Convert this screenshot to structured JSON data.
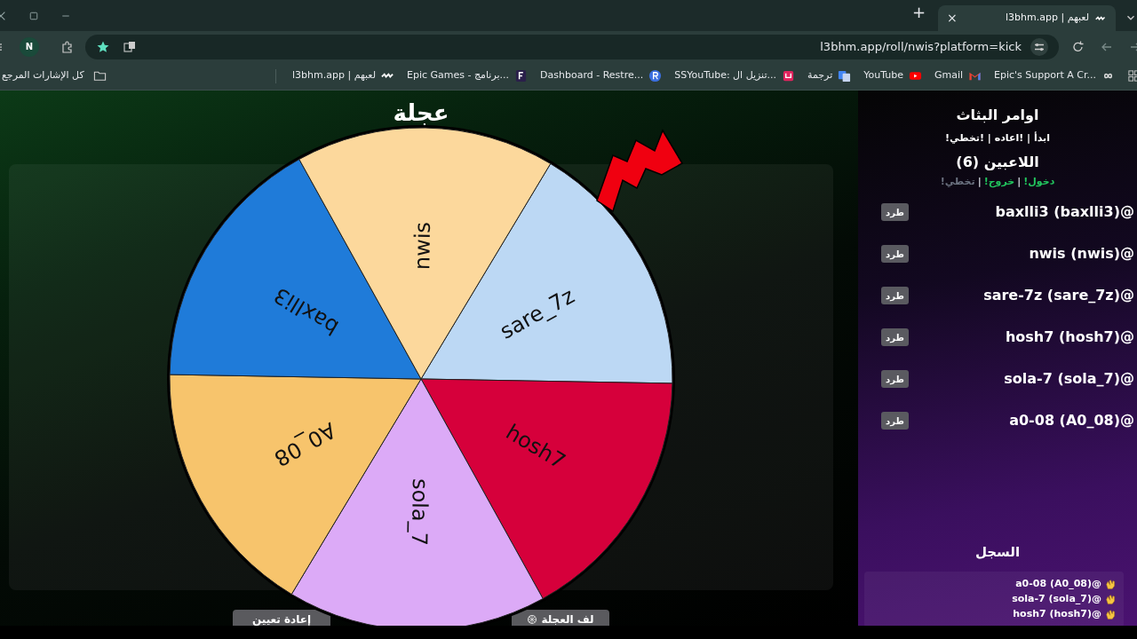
{
  "browser": {
    "tab": {
      "title": "l3bhm.app | لعبهم",
      "close": "×"
    },
    "new_tab": "+",
    "url": "l3bhm.app/roll/nwis?platform=kick",
    "avatar": "N",
    "bookmarks": [
      {
        "label": "Epic's Support A Cr...",
        "kind": "infinity"
      },
      {
        "label": "Gmail",
        "kind": "gmail"
      },
      {
        "label": "YouTube",
        "kind": "youtube"
      },
      {
        "label": "ترجمة",
        "kind": "translate"
      },
      {
        "label": "SSYouTube: تنزيل ال...",
        "kind": "square"
      },
      {
        "label": "Dashboard - Restre...",
        "kind": "r"
      },
      {
        "label": "Epic Games - برنامج...",
        "kind": "f"
      },
      {
        "label": "l3bhm.app | لعبهم",
        "kind": "site"
      }
    ],
    "all_bookmarks": "كل الإشارات المرجع"
  },
  "wheel": {
    "title": "عجلة",
    "slices": [
      {
        "label": "sare_7z",
        "color": "#bcd8f4"
      },
      {
        "label": "hosh7",
        "color": "#d6003b"
      },
      {
        "label": "sola_7",
        "color": "#dcaaf7"
      },
      {
        "label": "A0_08",
        "color": "#f7c46c"
      },
      {
        "label": "baxlli3",
        "color": "#1f7bd9"
      },
      {
        "label": "nwis",
        "color": "#fcd89c"
      }
    ],
    "buttons": [
      {
        "label": "لف العجلة",
        "kind": "spin"
      },
      {
        "label": "إعادة تعيين",
        "kind": "reset"
      }
    ]
  },
  "panel": {
    "title": "اوامر البثاث",
    "commands": "!ابدأ | !اعاده | !تخطي",
    "players_title": "اللاعبين (6)",
    "legend": [
      {
        "label": "!دخول",
        "color": "#22c55e"
      },
      {
        "label": "!خروج",
        "color": "#22c55e"
      },
      {
        "label": "!تخطي",
        "color": "#6b7280"
      }
    ],
    "legend_separator": "|",
    "players": [
      {
        "name": "baxlli3 (baxlli3)@",
        "action": "طرد"
      },
      {
        "name": "nwis (nwis)@",
        "action": "طرد"
      },
      {
        "name": "sare-7z (sare_7z)@",
        "action": "طرد"
      },
      {
        "name": "hosh7 (hosh7)@",
        "action": "طرد"
      },
      {
        "name": "sola-7 (sola_7)@",
        "action": "طرد"
      },
      {
        "name": "a0-08 (A0_08)@",
        "action": "طرد"
      }
    ],
    "log_title": "السجل",
    "log": [
      "a0-08 (A0_08)@",
      "sola-7 (sola_7)@",
      "hosh7 (hosh7)@"
    ]
  }
}
